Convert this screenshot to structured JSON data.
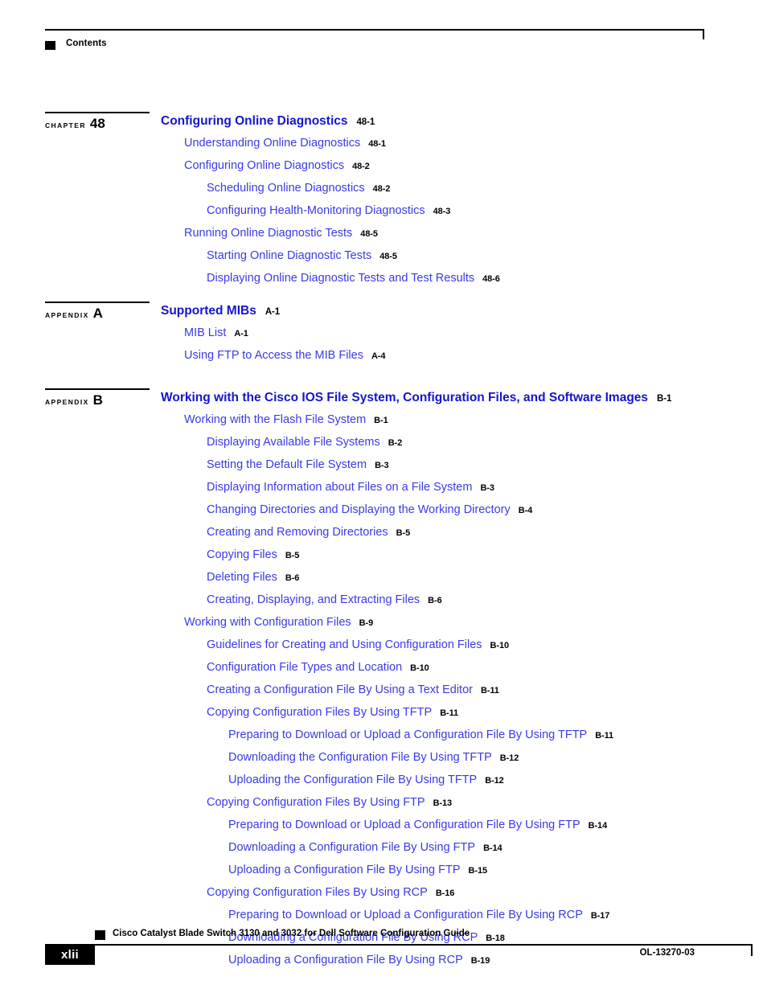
{
  "header": {
    "label": "Contents"
  },
  "colors": {
    "title_blue": "#1414d2",
    "entry_blue": "#3a3ae8",
    "page_black": "#000000"
  },
  "sections": [
    {
      "kind": "CHAPTER",
      "number": "48",
      "title": "Configuring Online Diagnostics",
      "title_page": "48-1",
      "entries": [
        {
          "level": 1,
          "text": "Understanding Online Diagnostics",
          "page": "48-1"
        },
        {
          "level": 1,
          "text": "Configuring Online Diagnostics",
          "page": "48-2"
        },
        {
          "level": 2,
          "text": "Scheduling Online Diagnostics",
          "page": "48-2"
        },
        {
          "level": 2,
          "text": "Configuring Health-Monitoring Diagnostics",
          "page": "48-3"
        },
        {
          "level": 1,
          "text": "Running Online Diagnostic Tests",
          "page": "48-5"
        },
        {
          "level": 2,
          "text": "Starting Online Diagnostic Tests",
          "page": "48-5"
        },
        {
          "level": 2,
          "text": "Displaying Online Diagnostic Tests and Test Results",
          "page": "48-6"
        }
      ]
    },
    {
      "kind": "APPENDIX",
      "number": "A",
      "title": "Supported MIBs",
      "title_page": "A-1",
      "entries": [
        {
          "level": 1,
          "text": "MIB List",
          "page": "A-1"
        },
        {
          "level": 1,
          "text": "Using FTP to Access the MIB Files",
          "page": "A-4"
        }
      ]
    },
    {
      "kind": "APPENDIX",
      "number": "B",
      "title": "Working with the Cisco IOS File System, Configuration Files, and Software Images",
      "title_page": "B-1",
      "entries": [
        {
          "level": 1,
          "text": "Working with the Flash File System",
          "page": "B-1"
        },
        {
          "level": 2,
          "text": "Displaying Available File Systems",
          "page": "B-2"
        },
        {
          "level": 2,
          "text": "Setting the Default File System",
          "page": "B-3"
        },
        {
          "level": 2,
          "text": "Displaying Information about Files on a File System",
          "page": "B-3"
        },
        {
          "level": 2,
          "text": "Changing Directories and Displaying the Working Directory",
          "page": "B-4"
        },
        {
          "level": 2,
          "text": "Creating and Removing Directories",
          "page": "B-5"
        },
        {
          "level": 2,
          "text": "Copying Files",
          "page": "B-5"
        },
        {
          "level": 2,
          "text": "Deleting Files",
          "page": "B-6"
        },
        {
          "level": 2,
          "text": "Creating, Displaying, and Extracting Files",
          "page": "B-6"
        },
        {
          "level": 1,
          "text": "Working with Configuration Files",
          "page": "B-9"
        },
        {
          "level": 2,
          "text": "Guidelines for Creating and Using Configuration Files",
          "page": "B-10"
        },
        {
          "level": 2,
          "text": "Configuration File Types and Location",
          "page": "B-10"
        },
        {
          "level": 2,
          "text": "Creating a Configuration File By Using a Text Editor",
          "page": "B-11"
        },
        {
          "level": 2,
          "text": "Copying Configuration Files By Using TFTP",
          "page": "B-11"
        },
        {
          "level": 3,
          "text": "Preparing to Download or Upload a Configuration File By Using TFTP",
          "page": "B-11"
        },
        {
          "level": 3,
          "text": "Downloading the Configuration File By Using TFTP",
          "page": "B-12"
        },
        {
          "level": 3,
          "text": "Uploading the Configuration File By Using TFTP",
          "page": "B-12"
        },
        {
          "level": 2,
          "text": "Copying Configuration Files By Using FTP",
          "page": "B-13"
        },
        {
          "level": 3,
          "text": "Preparing to Download or Upload a Configuration File By Using FTP",
          "page": "B-14"
        },
        {
          "level": 3,
          "text": "Downloading a Configuration File By Using FTP",
          "page": "B-14"
        },
        {
          "level": 3,
          "text": "Uploading a Configuration File By Using FTP",
          "page": "B-15"
        },
        {
          "level": 2,
          "text": "Copying Configuration Files By Using RCP",
          "page": "B-16"
        },
        {
          "level": 3,
          "text": "Preparing to Download or Upload a Configuration File By Using RCP",
          "page": "B-17"
        },
        {
          "level": 3,
          "text": "Downloading a Configuration File By Using RCP",
          "page": "B-18"
        },
        {
          "level": 3,
          "text": "Uploading a Configuration File By Using RCP",
          "page": "B-19"
        }
      ]
    }
  ],
  "footer": {
    "guide_title": "Cisco Catalyst Blade Switch 3130 and 3032 for Dell Software Configuration Guide",
    "page_number": "xlii",
    "doc_id": "OL-13270-03"
  }
}
